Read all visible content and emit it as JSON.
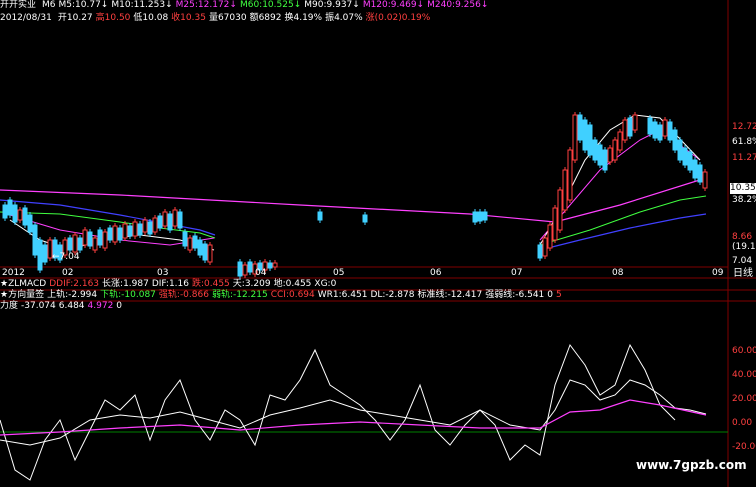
{
  "header": {
    "stock_name": "开开实业",
    "ma_items": [
      {
        "label": "M6",
        "value": "M5:10.77",
        "color": "#ffffff"
      },
      {
        "label": "M10",
        "value": "M10:11.253",
        "color": "#ffffff"
      },
      {
        "label": "M25",
        "value": "M25:12.172",
        "color": "#ff40ff"
      },
      {
        "label": "M60",
        "value": "M60:10.525",
        "color": "#40ff40"
      },
      {
        "label": "M90",
        "value": "M90:9.937",
        "color": "#ffffff"
      },
      {
        "label": "M120",
        "value": "M120:9.469",
        "color": "#ff40ff"
      },
      {
        "label": "M240",
        "value": "M240:9.256",
        "color": "#ff40ff"
      }
    ],
    "date": "2012/08/31",
    "quote_items": [
      {
        "label": "开10.27",
        "color": "#ffffff"
      },
      {
        "label": "高10.50",
        "color": "#ff4040"
      },
      {
        "label": "低10.08",
        "color": "#ffffff"
      },
      {
        "label": "收10.35",
        "color": "#ff4040"
      },
      {
        "label": "量67030",
        "color": "#ffffff"
      },
      {
        "label": "额6892",
        "color": "#ffffff"
      },
      {
        "label": "换4.19%",
        "color": "#ffffff"
      },
      {
        "label": "振4.07%",
        "color": "#ffffff"
      },
      {
        "label": "涨(0.02)0.19%",
        "color": "#ff4040"
      }
    ]
  },
  "price_axis": {
    "labels": [
      {
        "text": "12.72",
        "color": "#ff4040"
      },
      {
        "text": "61.8%",
        "color": "#ffffff"
      },
      {
        "text": "11.27",
        "color": "#ff4040"
      },
      {
        "text": "10.35",
        "color": "#ffffff"
      },
      {
        "text": "38.2%",
        "color": "#ffffff"
      },
      {
        "text": "8.66",
        "color": "#ff4040"
      },
      {
        "text": "(19.1%",
        "color": "#ffffff"
      },
      {
        "text": "7.04",
        "color": "#ffffff"
      }
    ],
    "low_marker": "7.04"
  },
  "time_axis": {
    "labels": [
      "2012",
      "02",
      "03",
      "04",
      "05",
      "06",
      "07",
      "08",
      "09"
    ],
    "period": "日线"
  },
  "indicator_row1": [
    {
      "text": "★ZLMACD",
      "color": "#ffffff"
    },
    {
      "text": "DDIF:2.163",
      "color": "#ff4040"
    },
    {
      "text": "长涨:1.987",
      "color": "#ffffff"
    },
    {
      "text": "DIF:1.16",
      "color": "#ffffff"
    },
    {
      "text": "跌:0.455",
      "color": "#ff4040"
    },
    {
      "text": "天:3.209",
      "color": "#ffffff"
    },
    {
      "text": "地:0.455",
      "color": "#ffffff"
    },
    {
      "text": "XG:0",
      "color": "#ffffff"
    }
  ],
  "indicator_row2": [
    {
      "text": "★方向量签",
      "color": "#ffffff"
    },
    {
      "text": "上轨:-2.994",
      "color": "#ffffff"
    },
    {
      "text": "下轨:-10.087",
      "color": "#40ff40"
    },
    {
      "text": "强轨:-0.866",
      "color": "#ff4040"
    },
    {
      "text": "弱轨:-12.215",
      "color": "#40ff40"
    },
    {
      "text": "CCI:0.694",
      "color": "#ff4040"
    },
    {
      "text": "WR1:6.451",
      "color": "#ffffff"
    },
    {
      "text": "DL:-2.878",
      "color": "#ffffff"
    },
    {
      "text": "标准线:-12.417",
      "color": "#ffffff"
    },
    {
      "text": "强弱线:-6.541",
      "color": "#ffffff"
    },
    {
      "text": "0",
      "color": "#ffffff"
    },
    {
      "text": "5",
      "color": "#ff4040"
    }
  ],
  "indicator_row3": [
    {
      "text": "力度",
      "color": "#ffffff"
    },
    {
      "text": "-37.074",
      "color": "#ffffff"
    },
    {
      "text": "6.484",
      "color": "#ffffff"
    },
    {
      "text": "4.972",
      "color": "#ff40ff"
    },
    {
      "text": "0",
      "color": "#ffffff"
    }
  ],
  "osc_axis": {
    "labels": [
      "60.00",
      "40.00",
      "20.00",
      "0.00",
      "-20.00"
    ]
  },
  "watermark": "www.7gpzb.com",
  "colors": {
    "background": "#000000",
    "up": "#ff4040",
    "down": "#40d0ff",
    "grid": "#800000"
  }
}
